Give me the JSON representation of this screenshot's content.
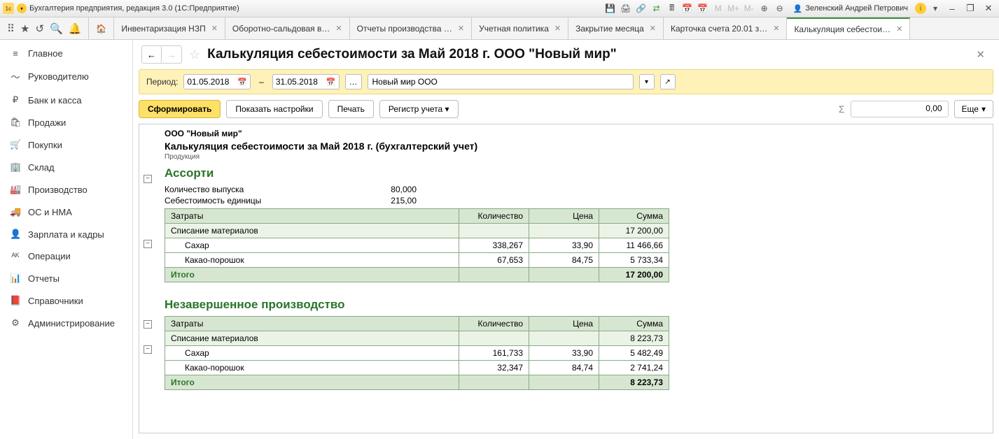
{
  "titlebar": {
    "app_title": "Бухгалтерия предприятия, редакция 3.0  (1С:Предприятие)",
    "user_name": "Зеленский Андрей Петрович"
  },
  "tabs": [
    {
      "label": "Инвентаризация НЗП"
    },
    {
      "label": "Оборотно-сальдовая в…"
    },
    {
      "label": "Отчеты производства …"
    },
    {
      "label": "Учетная политика"
    },
    {
      "label": "Закрытие месяца"
    },
    {
      "label": "Карточка счета 20.01 з…"
    },
    {
      "label": "Калькуляция себестои…",
      "active": true
    }
  ],
  "sidebar": [
    {
      "icon": "≡",
      "label": "Главное"
    },
    {
      "icon": "〜",
      "label": "Руководителю"
    },
    {
      "icon": "₽",
      "label": "Банк и касса"
    },
    {
      "icon": "🛍",
      "label": "Продажи"
    },
    {
      "icon": "🛒",
      "label": "Покупки"
    },
    {
      "icon": "🏢",
      "label": "Склад"
    },
    {
      "icon": "🏭",
      "label": "Производство"
    },
    {
      "icon": "🚚",
      "label": "ОС и НМА"
    },
    {
      "icon": "👤",
      "label": "Зарплата и кадры"
    },
    {
      "icon": "ᴬᴷ",
      "label": "Операции"
    },
    {
      "icon": "📊",
      "label": "Отчеты"
    },
    {
      "icon": "📕",
      "label": "Справочники"
    },
    {
      "icon": "⚙",
      "label": "Администрирование"
    }
  ],
  "page": {
    "title": "Калькуляция себестоимости за Май 2018 г. ООО \"Новый мир\"",
    "period_label": "Период:",
    "date_from": "01.05.2018",
    "date_to": "31.05.2018",
    "org": "Новый мир ООО",
    "btn_generate": "Сформировать",
    "btn_settings": "Показать настройки",
    "btn_print": "Печать",
    "btn_register": "Регистр учета",
    "sum_value": "0,00",
    "btn_more": "Еще"
  },
  "report": {
    "company": "ООО \"Новый мир\"",
    "title": "Калькуляция себестоимости за Май 2018 г. (бухгалтерский учет)",
    "subtitle": "Продукция",
    "section1": {
      "heading": "Ассорти",
      "rows": [
        {
          "label": "Количество выпуска",
          "value": "80,000"
        },
        {
          "label": "Себестоимость единицы",
          "value": "215,00"
        }
      ],
      "cols": {
        "c0": "Затраты",
        "c1": "Количество",
        "c2": "Цена",
        "c3": "Сумма"
      },
      "group": {
        "name": "Списание материалов",
        "sum": "17 200,00"
      },
      "items": [
        {
          "name": "Сахар",
          "qty": "338,267",
          "price": "33,90",
          "sum": "11 466,66"
        },
        {
          "name": "Какао-порошок",
          "qty": "67,653",
          "price": "84,75",
          "sum": "5 733,34"
        }
      ],
      "total": {
        "label": "Итого",
        "sum": "17 200,00"
      }
    },
    "section2": {
      "heading": "Незавершенное производство",
      "cols": {
        "c0": "Затраты",
        "c1": "Количество",
        "c2": "Цена",
        "c3": "Сумма"
      },
      "group": {
        "name": "Списание материалов",
        "sum": "8 223,73"
      },
      "items": [
        {
          "name": "Сахар",
          "qty": "161,733",
          "price": "33,90",
          "sum": "5 482,49"
        },
        {
          "name": "Какао-порошок",
          "qty": "32,347",
          "price": "84,74",
          "sum": "2 741,24"
        }
      ],
      "total": {
        "label": "Итого",
        "sum": "8 223,73"
      }
    }
  }
}
